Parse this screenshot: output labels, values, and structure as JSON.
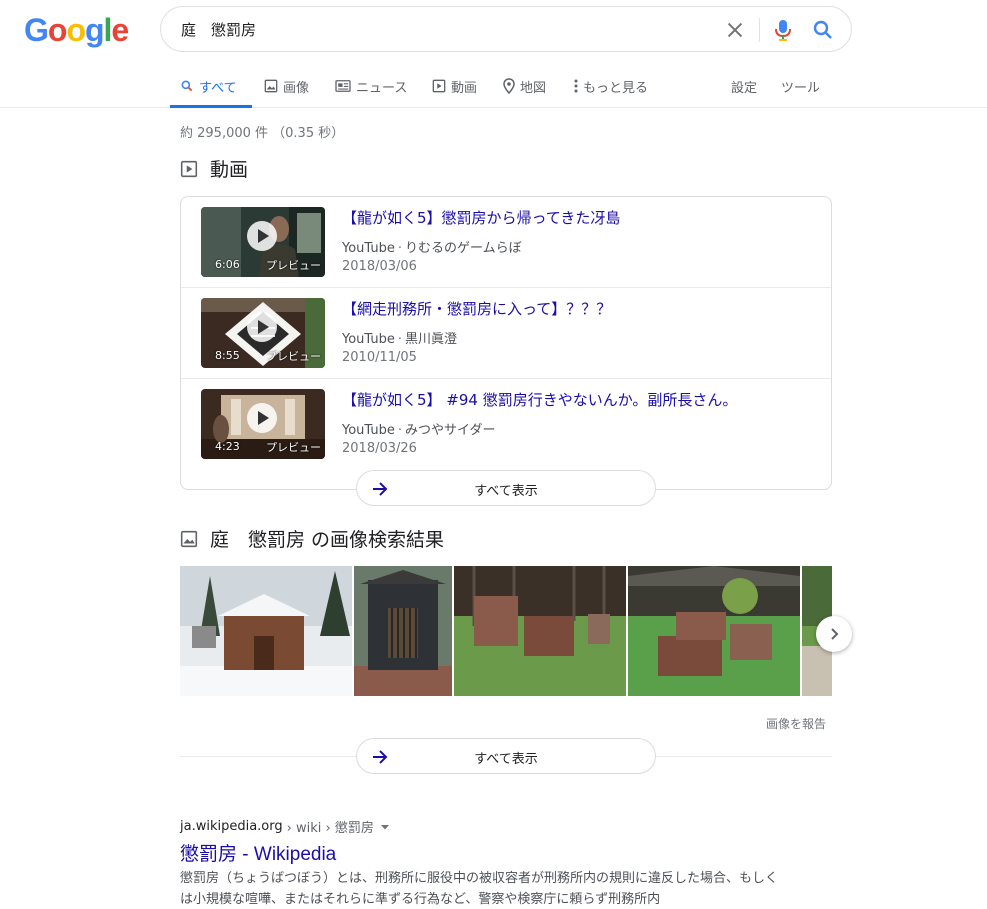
{
  "header": {
    "logo_letters": [
      "G",
      "o",
      "o",
      "g",
      "l",
      "e"
    ],
    "logo_colors": [
      "#4285F4",
      "#EA4335",
      "#FBBC05",
      "#4285F4",
      "#34A853",
      "#EA4335"
    ],
    "search_query": "庭　懲罰房",
    "clear_icon": "close-icon",
    "mic_icon": "microphone-icon",
    "search_icon": "search-icon"
  },
  "tabs": {
    "all": "すべて",
    "images": "画像",
    "news": "ニュース",
    "videos": "動画",
    "maps": "地図",
    "more": "もっと見る",
    "settings": "設定",
    "tools": "ツール"
  },
  "stats": "約 295,000 件 （0.35 秒）",
  "videos_section": {
    "heading": "動画",
    "items": [
      {
        "title": "【龍が如く5】懲罰房から帰ってきた冴島",
        "source": "YouTube",
        "channel": "りむるのゲームらぼ",
        "date": "2018/03/06",
        "duration": "6:06",
        "preview": "プレビュー"
      },
      {
        "title": "【網走刑務所・懲罰房に入って】？？？",
        "source": "YouTube",
        "channel": "黒川眞澄",
        "date": "2010/11/05",
        "duration": "8:55",
        "preview": "プレビュー"
      },
      {
        "title": "【龍が如く5】 #94 懲罰房行きやないんか。副所長さん。",
        "source": "YouTube",
        "channel": "みつやサイダー",
        "date": "2018/03/26",
        "duration": "4:23",
        "preview": "プレビュー"
      }
    ],
    "show_all": "すべて表示"
  },
  "images_section": {
    "heading": "庭　懲罰房 の画像検索結果",
    "report": "画像を報告",
    "show_all": "すべて表示"
  },
  "result": {
    "domain": "ja.wikipedia.org",
    "path": " › wiki › 懲罰房",
    "title": "懲罰房 - Wikipedia",
    "snippet": "懲罰房（ちょうばつぼう）とは、刑務所に服役中の被収容者が刑務所内の規則に違反した場合、もしくは小規模な喧嘩、またはそれらに準ずる行為など、警察や検察庁に頼らず刑務所内"
  },
  "colors": {
    "accent": "#1a73e8",
    "link": "#1a0dab",
    "muted": "#70757a"
  }
}
